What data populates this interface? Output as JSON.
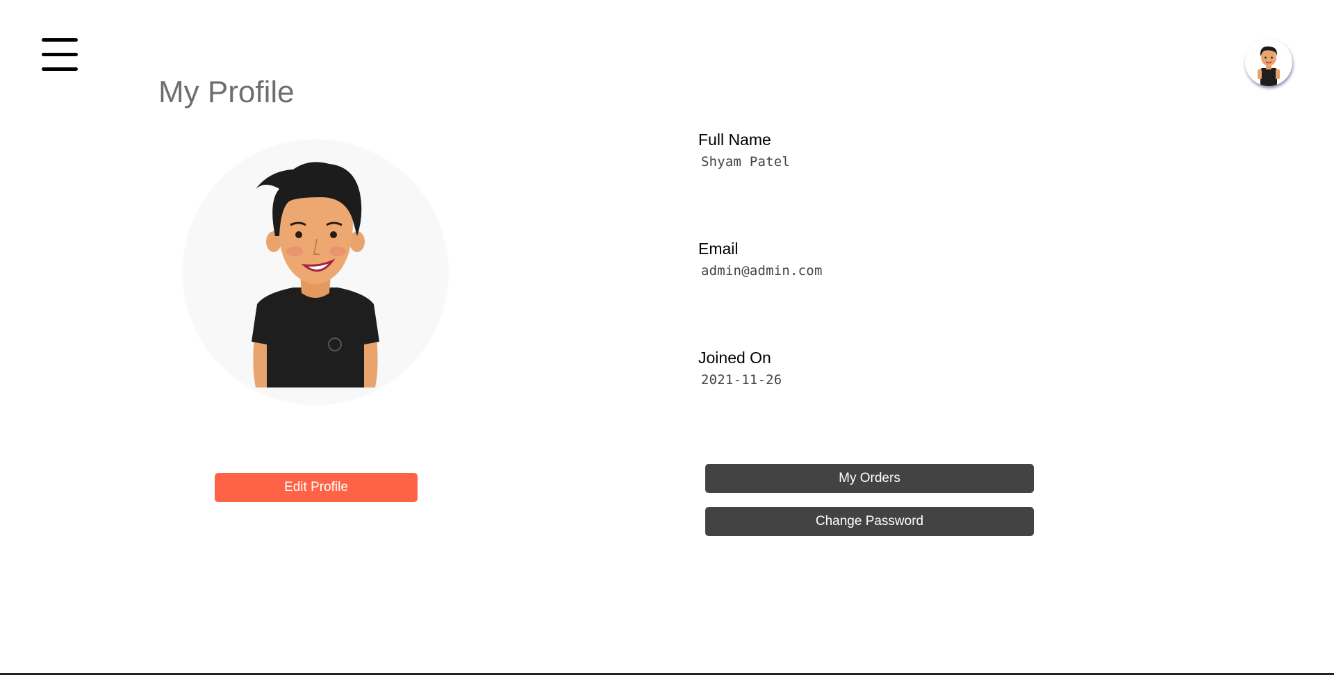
{
  "header": {
    "menu_icon": "hamburger-menu-icon",
    "avatar_icon": "user-avatar-icon"
  },
  "profile": {
    "title": "My Profile",
    "edit_button": "Edit Profile",
    "fields": {
      "full_name_label": "Full Name",
      "full_name_value": "Shyam Patel",
      "email_label": "Email",
      "email_value": "admin@admin.com",
      "joined_label": "Joined On",
      "joined_value": "2021-11-26"
    },
    "orders_button": "My Orders",
    "change_password_button": "Change Password"
  },
  "colors": {
    "accent": "#ff6347",
    "dark_button": "#434343",
    "title": "#6e6e6e"
  }
}
